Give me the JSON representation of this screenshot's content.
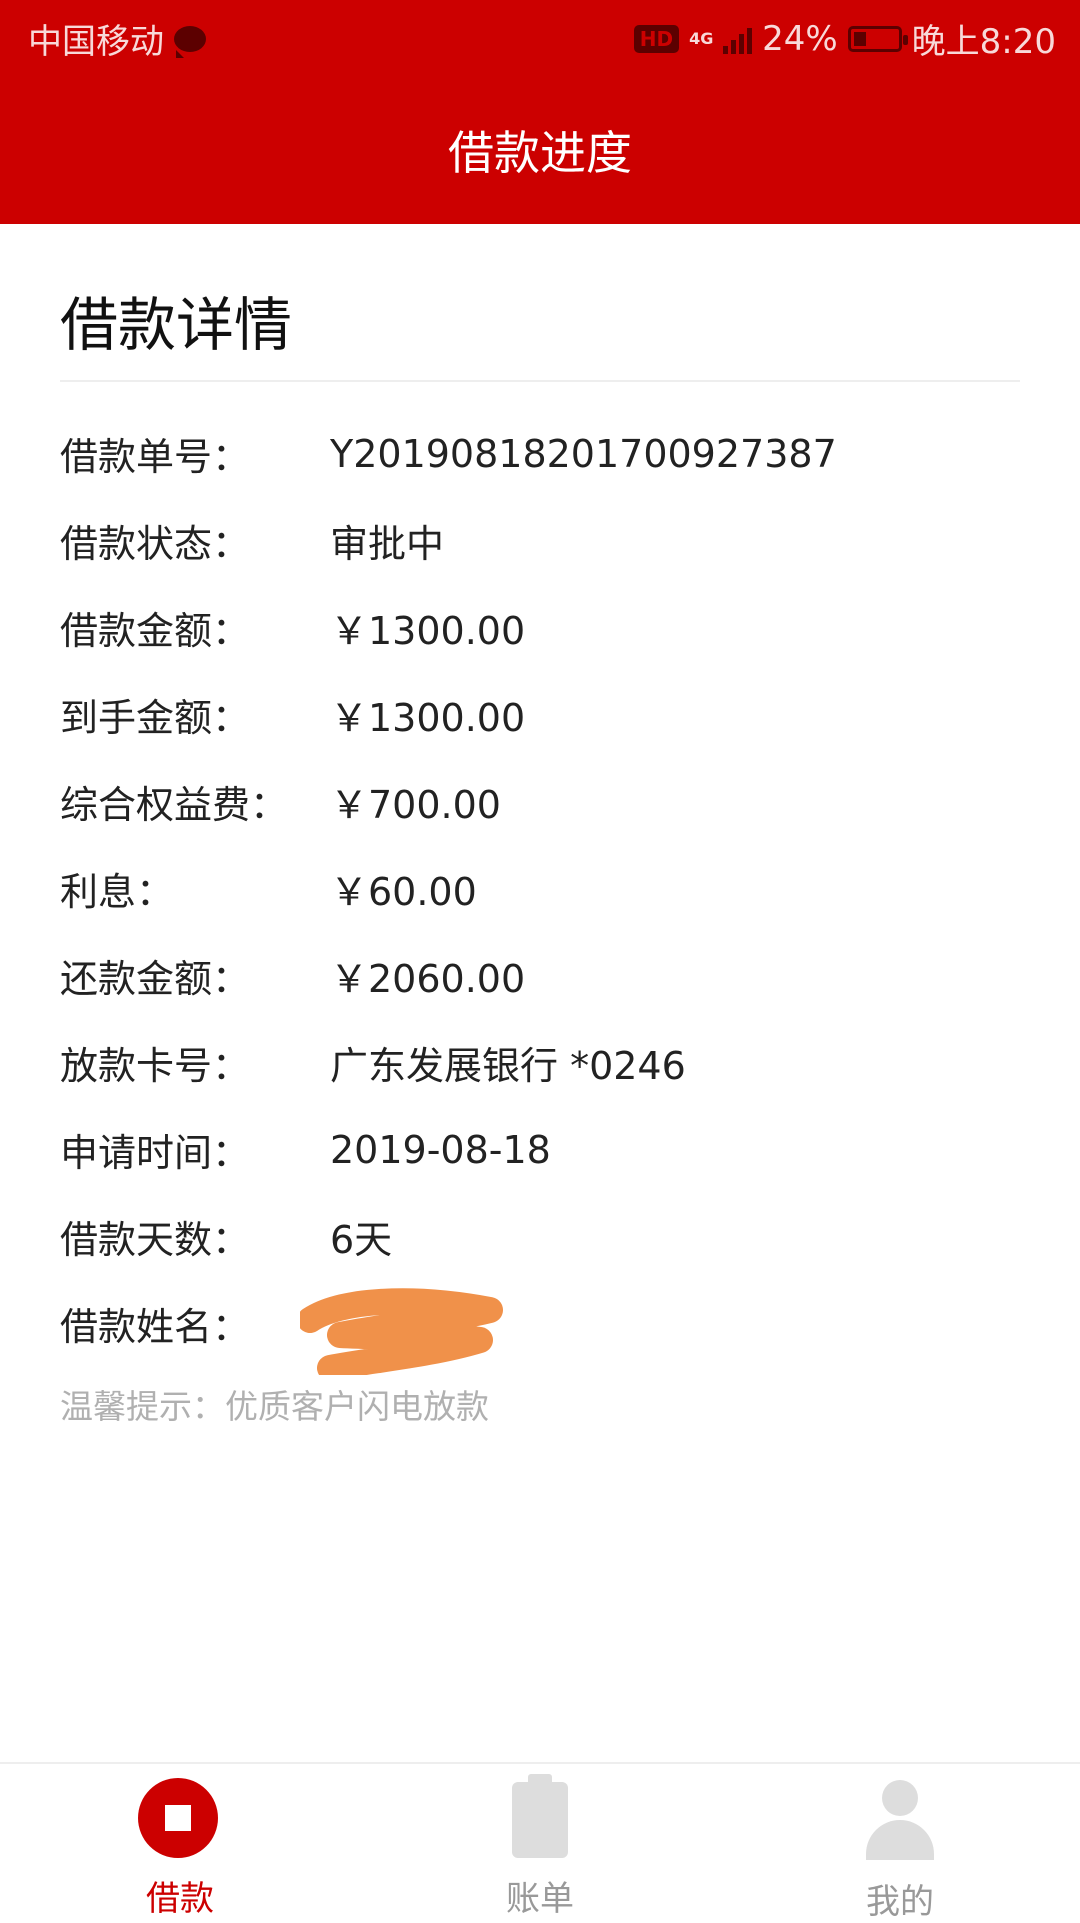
{
  "status_bar": {
    "carrier": "中国移动",
    "network": "4G",
    "battery": "24%",
    "time": "晚上8:20",
    "hd_badge": "HD"
  },
  "header": {
    "title": "借款进度"
  },
  "details": {
    "title": "借款详情",
    "rows": [
      {
        "label": "借款单号：",
        "value": "Y20190818201700927387"
      },
      {
        "label": "借款状态：",
        "value": "审批中"
      },
      {
        "label": "借款金额：",
        "value": "￥1300.00"
      },
      {
        "label": "到手金额：",
        "value": "￥1300.00"
      },
      {
        "label": "综合权益费：",
        "value": "￥700.00"
      },
      {
        "label": "利息：",
        "value": "￥60.00"
      },
      {
        "label": "还款金额：",
        "value": "￥2060.00"
      },
      {
        "label": "放款卡号：",
        "value": "广东发展银行 *0246"
      },
      {
        "label": "申请时间：",
        "value": "2019-08-18"
      },
      {
        "label": "借款天数：",
        "value": "6天"
      },
      {
        "label": "借款姓名：",
        "value": ""
      }
    ],
    "tip": "温馨提示：优质客户闪电放款"
  },
  "bottom_nav": {
    "items": [
      {
        "label": "借款",
        "active": true
      },
      {
        "label": "账单",
        "active": false
      },
      {
        "label": "我的",
        "active": false
      }
    ]
  },
  "colors": {
    "brand_red": "#cc0000",
    "inactive_icon": "#dddddd",
    "inactive_text": "#999999",
    "tip_text": "#b0b0b0",
    "scribble": "#f0914a"
  }
}
